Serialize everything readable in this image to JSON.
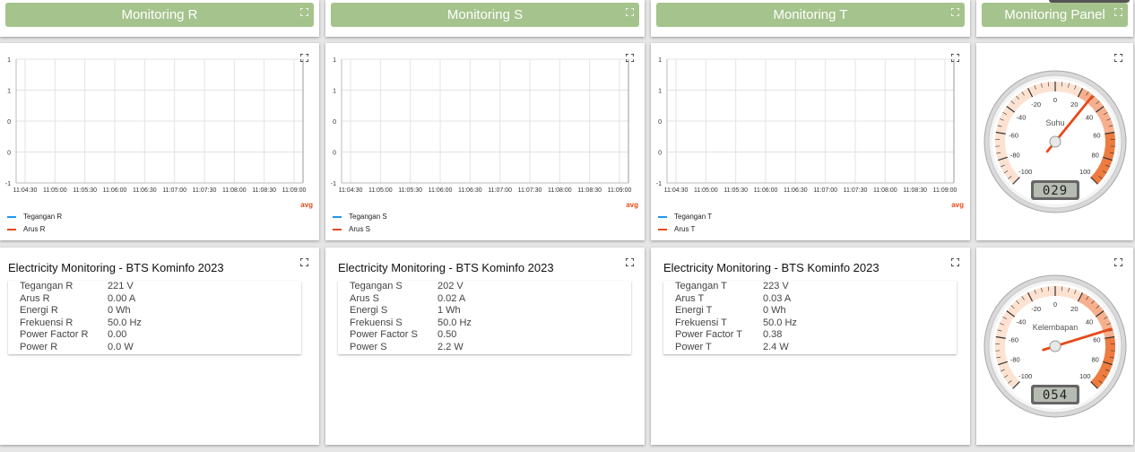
{
  "headers": [
    {
      "title": "Monitoring R"
    },
    {
      "title": "Monitoring S"
    },
    {
      "title": "Monitoring T"
    },
    {
      "title": "Monitoring Panel"
    }
  ],
  "charts": [
    {
      "chart_data": {
        "type": "line",
        "y_ticks": [
          "1",
          "1",
          "0",
          "0",
          "-1"
        ],
        "x": [
          "11:04:30",
          "11:05:00",
          "11:05:30",
          "11:06:00",
          "11:06:30",
          "11:07:00",
          "11:07:30",
          "11:08:00",
          "11:08:30",
          "11:09:00"
        ],
        "series": [
          {
            "name": "Tegangan R",
            "color": "#2196f3",
            "values": []
          },
          {
            "name": "Arus R",
            "color": "#e64a19",
            "values": []
          }
        ],
        "legend_extra": "avg"
      }
    },
    {
      "chart_data": {
        "type": "line",
        "y_ticks": [
          "1",
          "1",
          "0",
          "0",
          "-1"
        ],
        "x": [
          "11:04:30",
          "11:05:00",
          "11:05:30",
          "11:06:00",
          "11:06:30",
          "11:07:00",
          "11:07:30",
          "11:08:00",
          "11:08:30",
          "11:09:00"
        ],
        "series": [
          {
            "name": "Tegangan S",
            "color": "#2196f3",
            "values": []
          },
          {
            "name": "Arus S",
            "color": "#e64a19",
            "values": []
          }
        ],
        "legend_extra": "avg"
      }
    },
    {
      "chart_data": {
        "type": "line",
        "y_ticks": [
          "1",
          "1",
          "0",
          "0",
          "-1"
        ],
        "x": [
          "11:04:30",
          "11:05:00",
          "11:05:30",
          "11:06:00",
          "11:06:30",
          "11:07:00",
          "11:07:30",
          "11:08:00",
          "11:08:30",
          "11:09:00"
        ],
        "series": [
          {
            "name": "Tegangan T",
            "color": "#2196f3",
            "values": []
          },
          {
            "name": "Arus T",
            "color": "#e64a19",
            "values": []
          }
        ],
        "legend_extra": "avg"
      }
    }
  ],
  "tables": [
    {
      "title": "Electricity Monitoring - BTS Kominfo 2023",
      "rows": [
        {
          "label": "Tegangan R",
          "value": "221 V"
        },
        {
          "label": "Arus R",
          "value": "0.00 A"
        },
        {
          "label": "Energi R",
          "value": "0 Wh"
        },
        {
          "label": "Frekuensi R",
          "value": "50.0 Hz"
        },
        {
          "label": "Power Factor R",
          "value": "0.00"
        },
        {
          "label": "Power R",
          "value": "0.0 W"
        }
      ]
    },
    {
      "title": "Electricity Monitoring - BTS Kominfo 2023",
      "rows": [
        {
          "label": "Tegangan S",
          "value": "202 V"
        },
        {
          "label": "Arus S",
          "value": "0.02 A"
        },
        {
          "label": "Energi S",
          "value": "1 Wh"
        },
        {
          "label": "Frekuensi S",
          "value": "50.0 Hz"
        },
        {
          "label": "Power Factor S",
          "value": "0.50"
        },
        {
          "label": "Power S",
          "value": "2.2 W"
        }
      ]
    },
    {
      "title": "Electricity Monitoring - BTS Kominfo 2023",
      "rows": [
        {
          "label": "Tegangan T",
          "value": "223 V"
        },
        {
          "label": "Arus T",
          "value": "0.03 A"
        },
        {
          "label": "Energi T",
          "value": "0 Wh"
        },
        {
          "label": "Frekuensi T",
          "value": "50.0 Hz"
        },
        {
          "label": "Power Factor T",
          "value": "0.38"
        },
        {
          "label": "Power T",
          "value": "2.4 W"
        }
      ]
    }
  ],
  "gauges": [
    {
      "label": "Suhu",
      "value": 29,
      "display": "029",
      "min": -100,
      "max": 100,
      "ticks": [
        "-100",
        "-80",
        "-60",
        "-40",
        "-20",
        "0",
        "20",
        "40",
        "60",
        "80",
        "100"
      ]
    },
    {
      "label": "Kelembapan",
      "value": 54,
      "display": "054",
      "min": -100,
      "max": 100,
      "ticks": [
        "-100",
        "-80",
        "-60",
        "-40",
        "-20",
        "0",
        "20",
        "40",
        "60",
        "80",
        "100"
      ]
    }
  ],
  "colors": {
    "header_bg": "#a5c38c",
    "accent": "#e64a19",
    "series_blue": "#2196f3"
  },
  "icons": {
    "expand": "expand-icon"
  }
}
